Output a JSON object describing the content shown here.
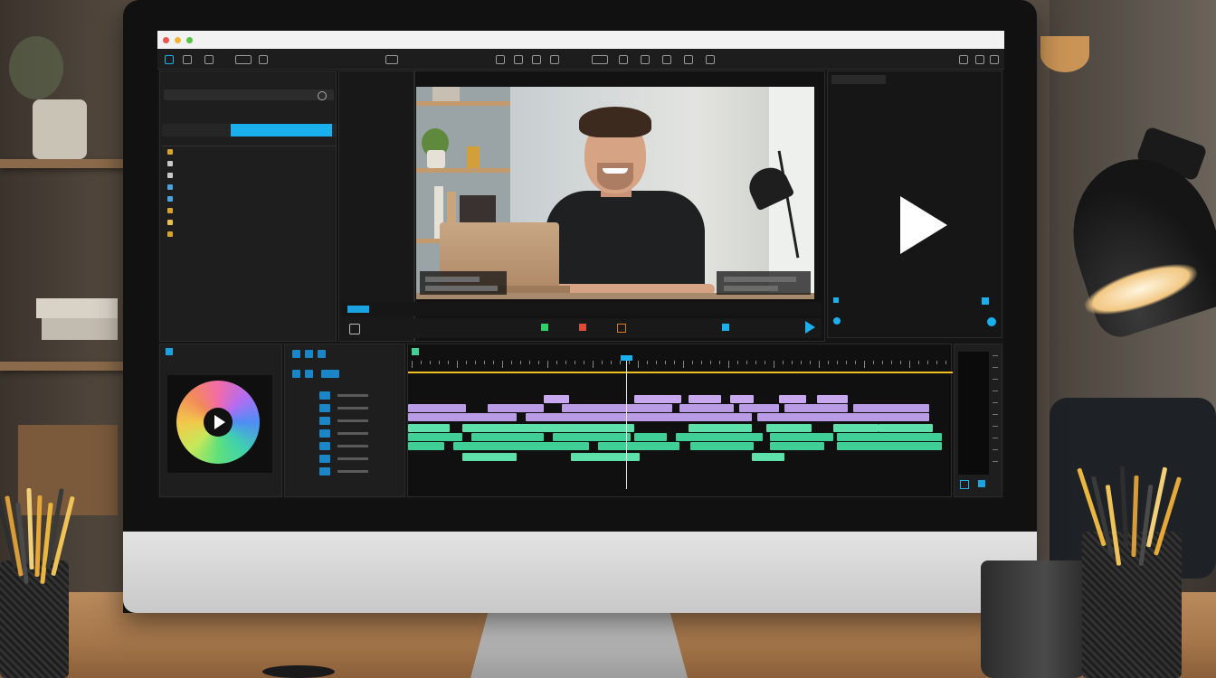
{
  "app": {
    "window_title": "",
    "menus": [
      "",
      "",
      "",
      "",
      ""
    ],
    "accent_color": "#1ab0ee",
    "timeline_purple": "#b99be6",
    "timeline_green": "#3fcf97",
    "playhead_color": "#f0c020"
  },
  "project_panel": {
    "header": "",
    "tabs": [
      {
        "label": ""
      },
      {
        "label": ""
      }
    ],
    "active_tab_index": 1,
    "items": [
      {
        "icon": "folder-icon",
        "name": "",
        "duration": ""
      },
      {
        "icon": "film-icon",
        "name": "",
        "duration": ""
      },
      {
        "icon": "film-icon",
        "name": "",
        "duration": ""
      },
      {
        "icon": "image-icon",
        "name": "",
        "duration": ""
      },
      {
        "icon": "image-icon",
        "name": "",
        "duration": ""
      },
      {
        "icon": "folder-icon",
        "name": "",
        "duration": ""
      },
      {
        "icon": "audio-icon",
        "name": "",
        "duration": ""
      },
      {
        "icon": "folder-icon",
        "name": "",
        "duration": ""
      }
    ]
  },
  "program_monitor": {
    "header": "",
    "timecode": "",
    "play_icon": "play-icon"
  },
  "source_monitor": {
    "header": "",
    "play_icon": "play-icon"
  },
  "color_panel": {
    "header": "",
    "wheel_icon": "color-wheel-icon",
    "footer": ""
  },
  "timeline": {
    "sequence_name": "",
    "playhead_position_pct": 40
  }
}
